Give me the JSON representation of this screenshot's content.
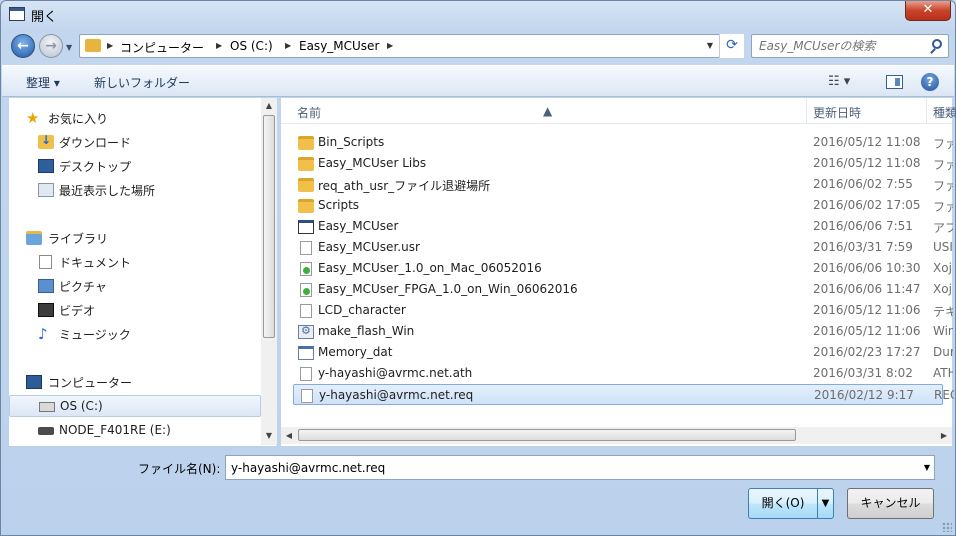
{
  "window": {
    "title": "開く",
    "close_label": "✕"
  },
  "address": {
    "crumbs": [
      "コンピューター",
      "OS (C:)",
      "Easy_MCUser"
    ],
    "search_placeholder": "Easy_MCUserの検索"
  },
  "toolbar": {
    "organize": "整理 ▾",
    "new_folder": "新しいフォルダー",
    "view": "☷ ▾",
    "help": "?"
  },
  "nav": {
    "favorites": "お気に入り",
    "downloads": "ダウンロード",
    "desktop": "デスクトップ",
    "recent": "最近表示した場所",
    "libraries": "ライブラリ",
    "documents": "ドキュメント",
    "pictures": "ピクチャ",
    "videos": "ビデオ",
    "music": "ミュージック",
    "computer": "コンピューター",
    "drive_c": "OS (C:)",
    "drive_e": "NODE_F401RE (E:)"
  },
  "columns": {
    "name": "名前",
    "date": "更新日時",
    "type": "種類"
  },
  "files": [
    {
      "name": "Bin_Scripts",
      "date": "2016/05/12 11:08",
      "type": "ファ",
      "icon": "folder"
    },
    {
      "name": "Easy_MCUser Libs",
      "date": "2016/05/12 11:08",
      "type": "ファ",
      "icon": "folder"
    },
    {
      "name": "req_ath_usr_ファイル退避場所",
      "date": "2016/06/02 7:55",
      "type": "ファ",
      "icon": "folder"
    },
    {
      "name": "Scripts",
      "date": "2016/06/02 17:05",
      "type": "ファ",
      "icon": "folder"
    },
    {
      "name": "Easy_MCUser",
      "date": "2016/06/06 7:51",
      "type": "アフ",
      "icon": "app"
    },
    {
      "name": "Easy_MCUser.usr",
      "date": "2016/03/31 7:59",
      "type": "USI",
      "icon": "doc"
    },
    {
      "name": "Easy_MCUser_1.0_on_Mac_06052016",
      "date": "2016/06/06 10:30",
      "type": "Xoj",
      "icon": "xojo"
    },
    {
      "name": "Easy_MCUser_FPGA_1.0_on_Win_06062016",
      "date": "2016/06/06 11:47",
      "type": "Xoj",
      "icon": "xojo"
    },
    {
      "name": "LCD_character",
      "date": "2016/05/12 11:06",
      "type": "テキ",
      "icon": "doc"
    },
    {
      "name": "make_flash_Win",
      "date": "2016/05/12 11:06",
      "type": "Win",
      "icon": "win"
    },
    {
      "name": "Memory_dat",
      "date": "2016/02/23 17:27",
      "type": "Dur",
      "icon": "dat"
    },
    {
      "name": "y-hayashi@avrmc.net.ath",
      "date": "2016/03/31 8:02",
      "type": "ATH",
      "icon": "doc"
    },
    {
      "name": "y-hayashi@avrmc.net.req",
      "date": "2016/02/12 9:17",
      "type": "REC",
      "icon": "doc",
      "selected": true
    }
  ],
  "bottom": {
    "filename_label": "ファイル名(N):",
    "filename_value": "y-hayashi@avrmc.net.req",
    "open_label": "開く(O)",
    "cancel_label": "キャンセル"
  }
}
